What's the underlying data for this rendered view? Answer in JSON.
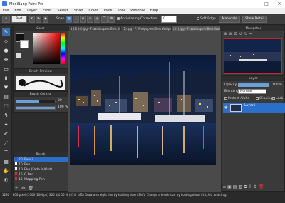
{
  "window": {
    "title": "MediBang Paint Pro",
    "minimize": "–",
    "maximize": "□",
    "close": "✕"
  },
  "menu": [
    "File",
    "Edit",
    "Layer",
    "Filter",
    "Select",
    "Snap",
    "Color",
    "View",
    "Tool",
    "Window",
    "Help"
  ],
  "toolbar": {
    "post_label": "Post",
    "snap_label": "Snap",
    "antialiasing_label": "AntiAliasing",
    "correction_label": "Correction",
    "correction_value": "0",
    "soft_edge_label": "Soft Edge",
    "materials_label": "Materials",
    "show_detail_label": "Show Detail"
  },
  "tabs": [
    "1 (2) (4).jpg - F:\\Wallpapers\\Best Wallpapers",
    "(2).jpg - F:\\Wallpapers\\Best Wallpapers",
    "(31).jpg - F:\\Wallpapers\\Best Wallpapers"
  ],
  "panels": {
    "color": "Color",
    "brush_preview": "Brush Preview",
    "brush_control": "Brush Control",
    "brush": "Brush",
    "navigator": "Navigator",
    "layer": "Layer"
  },
  "brush_control": {
    "size_value": "20",
    "opacity_value": "100 %"
  },
  "brushes": [
    {
      "size": "20",
      "name": "Pencil",
      "color": "#2a4fd8",
      "selected": true
    },
    {
      "size": "10",
      "name": "Pen",
      "color": "#ffffff",
      "selected": false
    },
    {
      "size": "10",
      "name": "Pen (Fade In/Out)",
      "color": "#ffffff",
      "selected": false
    },
    {
      "size": "15",
      "name": "G Pen",
      "color": "#d03030",
      "selected": false
    },
    {
      "size": "15",
      "name": "Mapping Pen",
      "color": "#d03030",
      "selected": false
    }
  ],
  "layer_panel": {
    "opacity_label": "Opacity",
    "opacity_value": "100 %",
    "blending_label": "Blending",
    "blending_value": "Normal",
    "protect_alpha_label": "Protect Alpha",
    "clipping_label": "Clipping",
    "lock_label": "Lock",
    "layer_name": "Layer1"
  },
  "navigator_zoom": "50",
  "statusbar": {
    "text": "1280 * 800 pixel (1000*1000px) 300 dpi 50 % (474, 181) Draw a straight line by holding down Shift, Change a brush size by holding down Ctrl, Alt, and drag"
  },
  "colors": {
    "accent": "#3b6ea5",
    "selected_brush": "#2a6fc9",
    "layer_selected": "#2a6fc9"
  }
}
